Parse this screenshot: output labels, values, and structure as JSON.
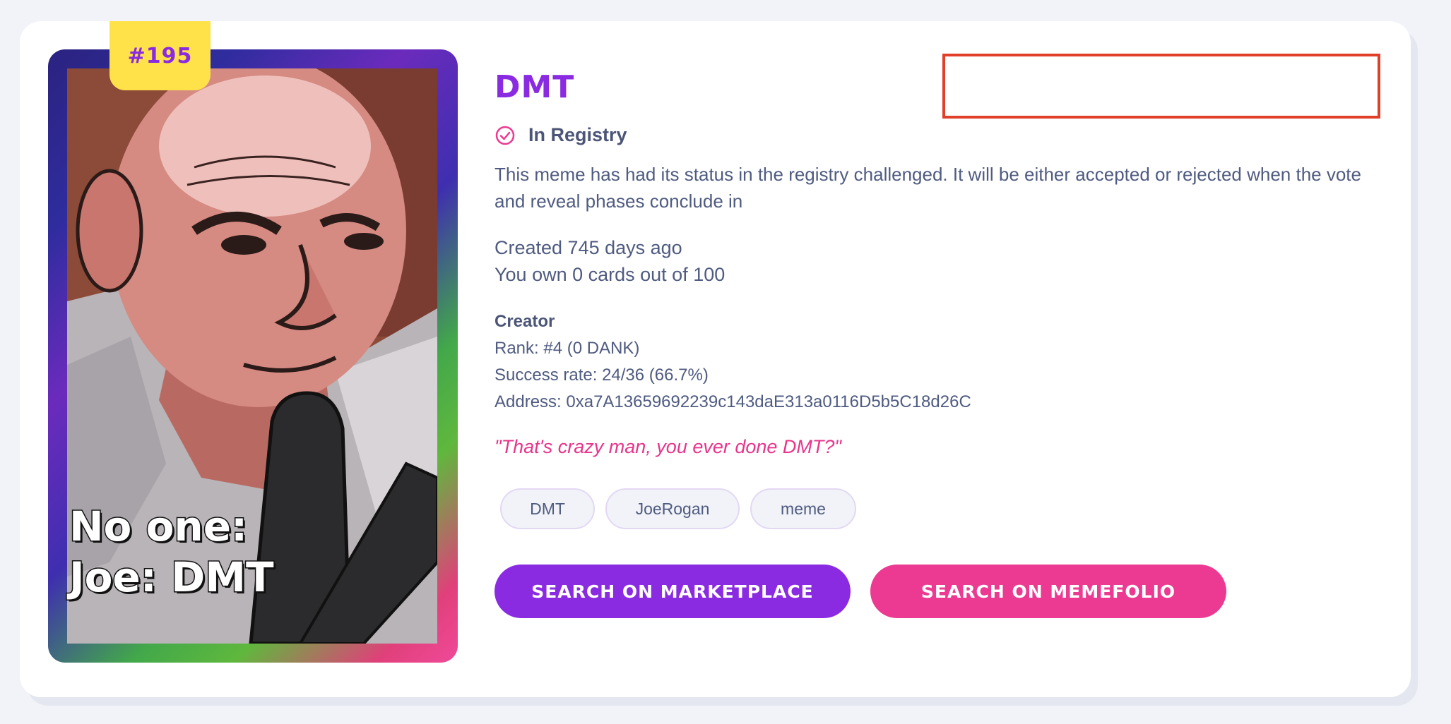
{
  "meme": {
    "number": "#195",
    "caption_line1": "No one:",
    "caption_line2": "Joe: DMT",
    "title": "DMT",
    "status": "In Registry",
    "description": "This meme has had its status in the registry challenged. It will be either accepted or rejected when the vote and reveal phases conclude in",
    "created": "Created 745 days ago",
    "ownership": "You own 0 cards out of 100",
    "quote": "\"That's crazy man, you ever done DMT?\""
  },
  "creator": {
    "heading": "Creator",
    "rank": "Rank: #4 (0 DANK)",
    "success_rate": "Success rate: 24/36 (66.7%)",
    "address": "Address: 0xa7A13659692239c143daE313a0116D5b5C18d26C"
  },
  "tags": [
    "DMT",
    "JoeRogan",
    "meme"
  ],
  "buttons": {
    "marketplace": "SEARCH ON MARKETPLACE",
    "memefolio": "SEARCH ON MEMEFOLIO"
  },
  "icons": {
    "status": "check-circle-icon"
  },
  "colors": {
    "primary": "#8a2be2",
    "accent": "#ec3a92",
    "badge": "#ffe24a",
    "highlight_box": "#e0402a"
  }
}
